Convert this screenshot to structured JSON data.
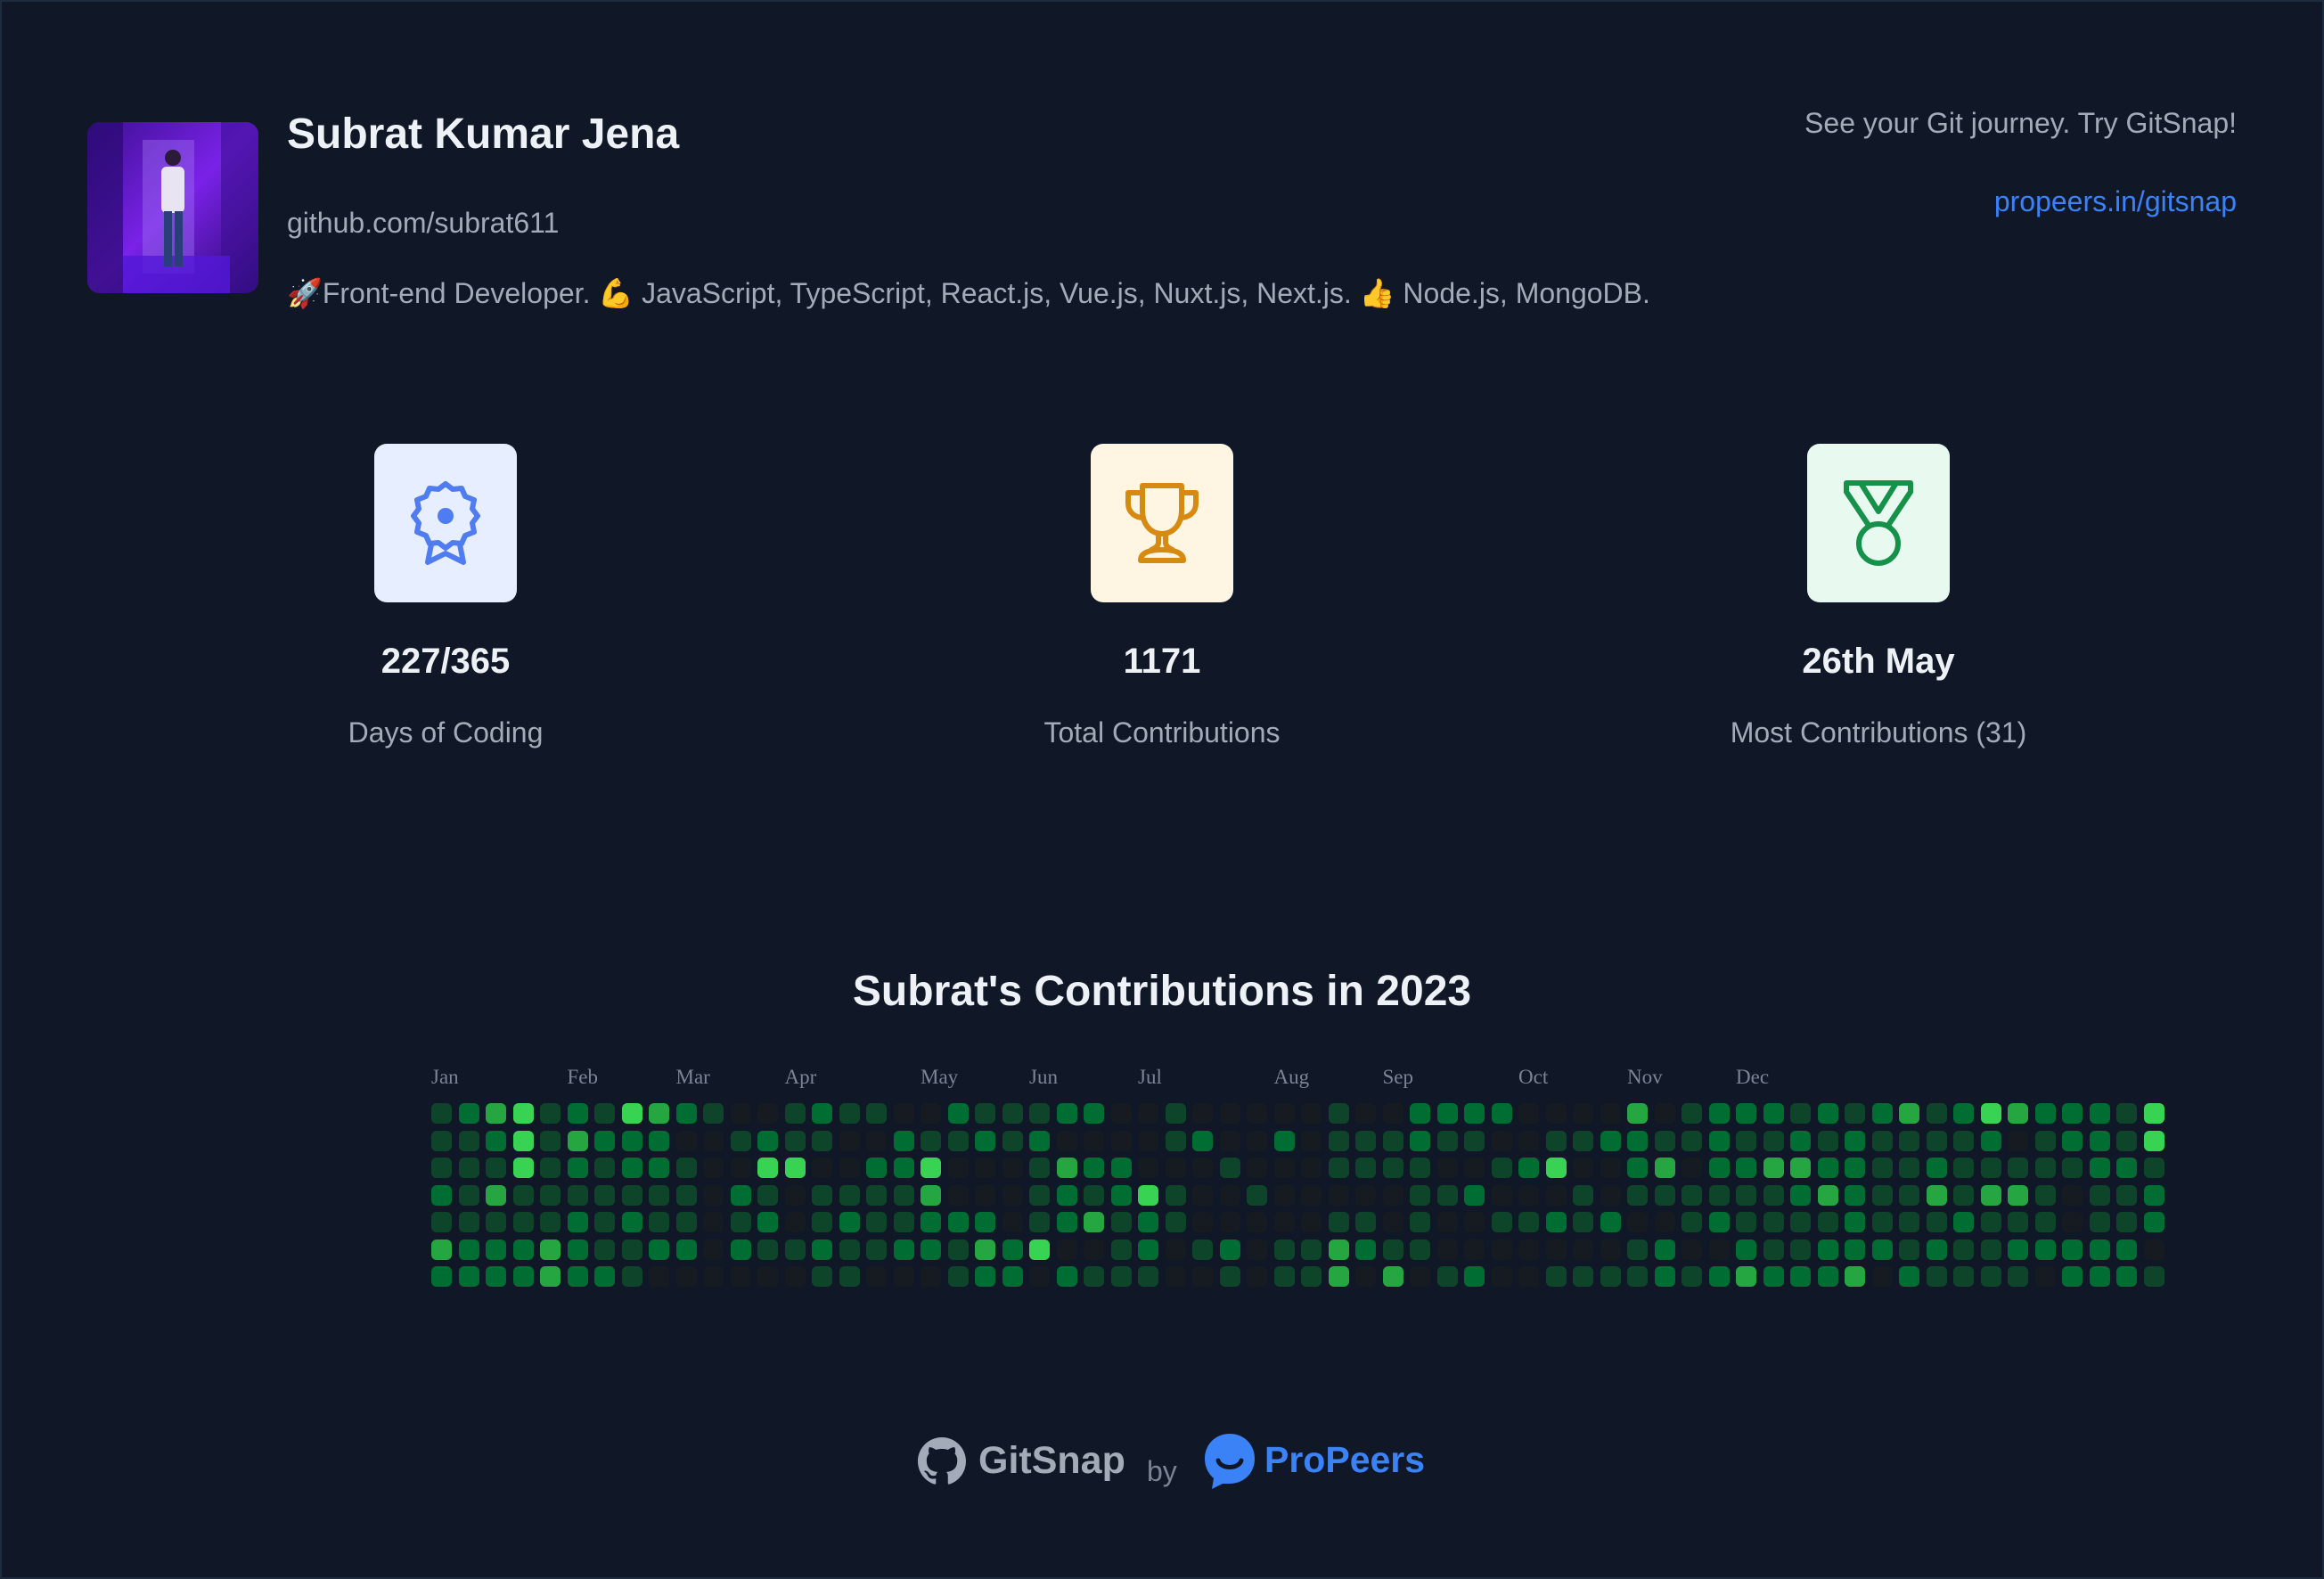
{
  "profile": {
    "name": "Subrat Kumar Jena",
    "handle": "github.com/subrat611",
    "bio": "🚀Front-end Developer. 💪 JavaScript, TypeScript, React.js, Vue.js, Nuxt.js, Next.js. 👍 Node.js, MongoDB."
  },
  "promo": {
    "text": "See your Git journey. Try GitSnap!",
    "link": "propeers.in/gitsnap"
  },
  "stats": [
    {
      "icon": "badge-icon",
      "value": "227/365",
      "label": "Days of Coding",
      "tile_color": "#e6eeff",
      "icon_color": "#4f7cf0"
    },
    {
      "icon": "trophy-icon",
      "value": "1171",
      "label": "Total Contributions",
      "tile_color": "#fff5e3",
      "icon_color": "#d68a12"
    },
    {
      "icon": "medal-icon",
      "value": "26th May",
      "label": "Most Contributions (31)",
      "tile_color": "#e8faf0",
      "icon_color": "#16914a"
    }
  ],
  "heatmap": {
    "title": "Subrat's Contributions in 2023",
    "months": [
      "Jan",
      "Feb",
      "Mar",
      "Apr",
      "May",
      "Jun",
      "Jul",
      "Aug",
      "Sep",
      "Oct",
      "Nov",
      "Dec"
    ],
    "colors": [
      "#161b22",
      "#0e4429",
      "#006d32",
      "#26a641",
      "#39d353"
    ],
    "levels": [
      "1234121432100121100211122001000001002222000030122212123124322214",
      "1124132220012110021121200001200201112110011221121121211112012214",
      "1114121221004400224000132200010001111001240023022332211211111221",
      "2131111111021011113000121241001000001120001011111123211313310112",
      "1111121211012012112220123121000001101001121200121111211121110112",
      "3222321122021121122132400120120113211000000012002112221211222220",
      "2222322100000011000122021110010113030120011112123222302111102221"
    ]
  },
  "footer": {
    "gitsnap": "GitSnap",
    "by": "by",
    "propeers": "ProPeers"
  }
}
